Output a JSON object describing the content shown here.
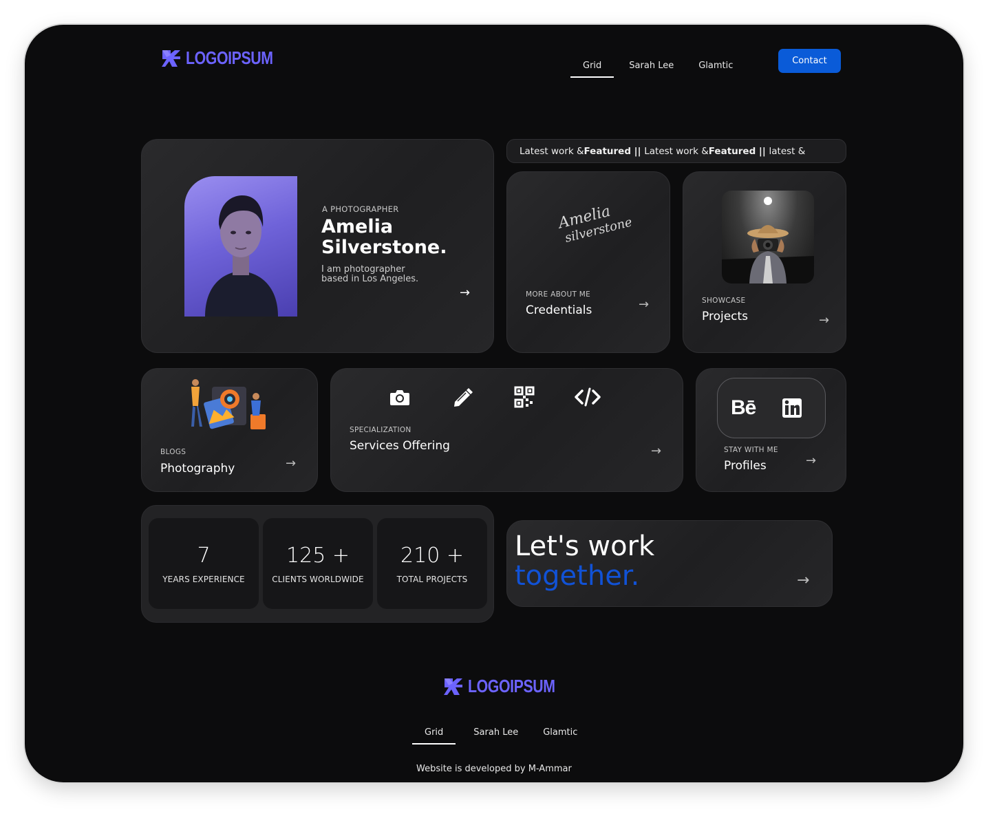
{
  "header": {
    "logo_text": "LOGOIPSUM",
    "nav": [
      {
        "label": "Grid",
        "active": true
      },
      {
        "label": "Sarah Lee",
        "active": false
      },
      {
        "label": "Glamtic",
        "active": false
      }
    ],
    "contact_label": "Contact"
  },
  "ticker": {
    "segments": [
      {
        "text": "Latest work & ",
        "bold": false
      },
      {
        "text": "Featured",
        "bold": true
      },
      {
        "text": " || ",
        "bold": true
      },
      {
        "text": "Latest work & ",
        "bold": false
      },
      {
        "text": "Featured",
        "bold": true
      },
      {
        "text": " || ",
        "bold": true
      },
      {
        "text": "latest &",
        "bold": false
      }
    ]
  },
  "profile": {
    "eyebrow": "A PHOTOGRAPHER",
    "name_line1": "Amelia",
    "name_line2": "Silverstone.",
    "bio_line1": "I am photographer",
    "bio_line2": "based in Los Angeles."
  },
  "credentials": {
    "signature_line1": "Amelia",
    "signature_line2": "silverstone",
    "eyebrow": "MORE ABOUT ME",
    "title": "Credentials"
  },
  "projects": {
    "eyebrow": "SHOWCASE",
    "title": "Projects"
  },
  "blogs": {
    "eyebrow": "BLOGS",
    "title": "Photography"
  },
  "services": {
    "eyebrow": "SPECIALIZATION",
    "title": "Services Offering",
    "icons": [
      "camera-icon",
      "pencil-icon",
      "qr-code-icon",
      "code-icon"
    ]
  },
  "profiles": {
    "eyebrow": "STAY WITH ME",
    "title": "Profiles",
    "behance_label": "Bē",
    "icons": [
      "behance-icon",
      "linkedin-icon"
    ]
  },
  "stats": [
    {
      "value": "7",
      "label": "YEARS EXPERIENCE"
    },
    {
      "value": "125 +",
      "label": "CLIENTS WORLDWIDE"
    },
    {
      "value": "210 +",
      "label": "TOTAL PROJECTS"
    }
  ],
  "cta": {
    "line1": "Let's work",
    "line2": "together."
  },
  "footer": {
    "logo_text": "LOGOIPSUM",
    "nav": [
      {
        "label": "Grid",
        "active": true
      },
      {
        "label": "Sarah Lee",
        "active": false
      },
      {
        "label": "Glamtic",
        "active": false
      }
    ],
    "credit": "Website is developed by M-Ammar"
  },
  "colors": {
    "accent": "#0a5bd8",
    "logo": "#6c63ff",
    "cta_highlight": "#1152d6",
    "background": "#0c0c0d",
    "card": "#252527"
  }
}
